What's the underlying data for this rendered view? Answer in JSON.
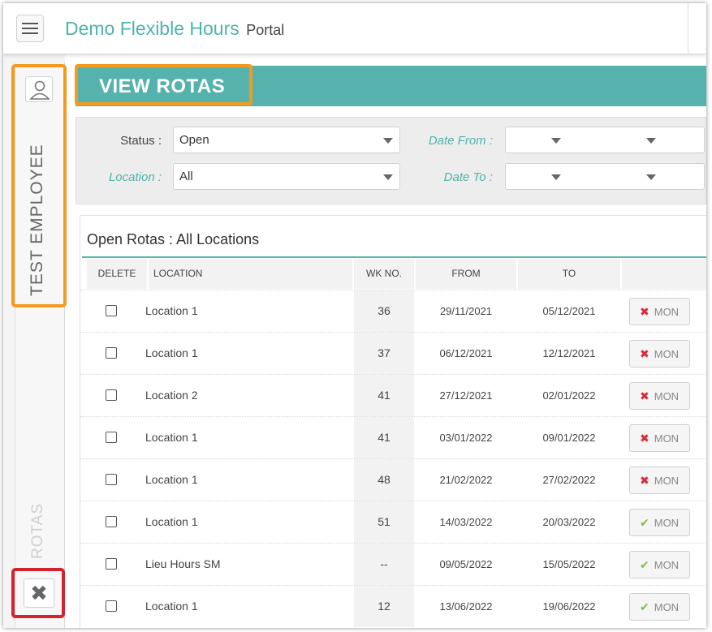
{
  "app": {
    "brand_name": "Demo Flexible Hours",
    "brand_sub": "Portal"
  },
  "sidebar": {
    "user_name": "TEST EMPLOYEE",
    "section_label": "ROTAS"
  },
  "page": {
    "title": "VIEW ROTAS"
  },
  "filters": {
    "status_label": "Status :",
    "status_value": "Open",
    "location_label": "Location :",
    "location_value": "All",
    "date_from_label": "Date From :",
    "date_to_label": "Date To :"
  },
  "table": {
    "title": "Open Rotas : All Locations",
    "headers": {
      "delete": "DELETE",
      "location": "LOCATION",
      "wk": "WK NO.",
      "from": "FROM",
      "to": "TO"
    },
    "rows": [
      {
        "location": "Location 1",
        "wk": "36",
        "from": "29/11/2021",
        "to": "05/12/2021",
        "day": "MON",
        "status": "cross"
      },
      {
        "location": "Location 1",
        "wk": "37",
        "from": "06/12/2021",
        "to": "12/12/2021",
        "day": "MON",
        "status": "cross"
      },
      {
        "location": "Location 2",
        "wk": "41",
        "from": "27/12/2021",
        "to": "02/01/2022",
        "day": "MON",
        "status": "cross"
      },
      {
        "location": "Location 1",
        "wk": "41",
        "from": "03/01/2022",
        "to": "09/01/2022",
        "day": "MON",
        "status": "cross"
      },
      {
        "location": "Location 1",
        "wk": "48",
        "from": "21/02/2022",
        "to": "27/02/2022",
        "day": "MON",
        "status": "cross"
      },
      {
        "location": "Location 1",
        "wk": "51",
        "from": "14/03/2022",
        "to": "20/03/2022",
        "day": "MON",
        "status": "check"
      },
      {
        "location": "Lieu Hours SM",
        "wk": "--",
        "from": "09/05/2022",
        "to": "15/05/2022",
        "day": "MON",
        "status": "check"
      },
      {
        "location": "Location 1",
        "wk": "12",
        "from": "13/06/2022",
        "to": "19/06/2022",
        "day": "MON",
        "status": "check"
      }
    ]
  },
  "colors": {
    "teal": "#56b2ac",
    "highlight_orange": "#f39a1e",
    "highlight_red": "#d12430",
    "cross": "#d42a3c",
    "check": "#7cbf3a"
  },
  "icons": {
    "menu": "hamburger-icon",
    "user": "user-icon",
    "close": "close-icon",
    "cross": "cross-icon",
    "check": "check-icon"
  }
}
